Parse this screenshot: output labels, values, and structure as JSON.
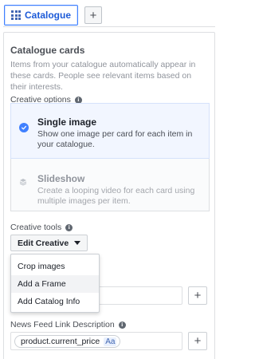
{
  "tabs": {
    "active_label": "Catalogue",
    "add_label": "+"
  },
  "section": {
    "title": "Catalogue cards",
    "description": "Items from your catalogue automatically appear in these cards. People see relevant items based on their interests."
  },
  "creative_options": {
    "label": "Creative options",
    "options": [
      {
        "title": "Single image",
        "description": "Show one image per card for each item in your catalogue.",
        "selected": true
      },
      {
        "title": "Slideshow",
        "description": "Create a looping video for each card using multiple images per item.",
        "selected": false
      }
    ]
  },
  "creative_tools": {
    "label": "Creative tools",
    "edit_button": "Edit Creative",
    "menu": [
      "Crop images",
      "Add a Frame",
      "Add Catalog Info"
    ],
    "hovered_index": 1
  },
  "news_feed": {
    "label": "News Feed Link Description",
    "token": "product.current_price",
    "token_badge": "Aa",
    "add_label": "+"
  },
  "colors": {
    "accent": "#4080ff",
    "selected_bg": "#f2f6ff",
    "text": "#1d2129",
    "muted": "#90949c"
  },
  "icons": [
    "grid-icon",
    "plus-icon",
    "info-icon",
    "check-icon",
    "stack-icon",
    "caret-down-icon"
  ]
}
